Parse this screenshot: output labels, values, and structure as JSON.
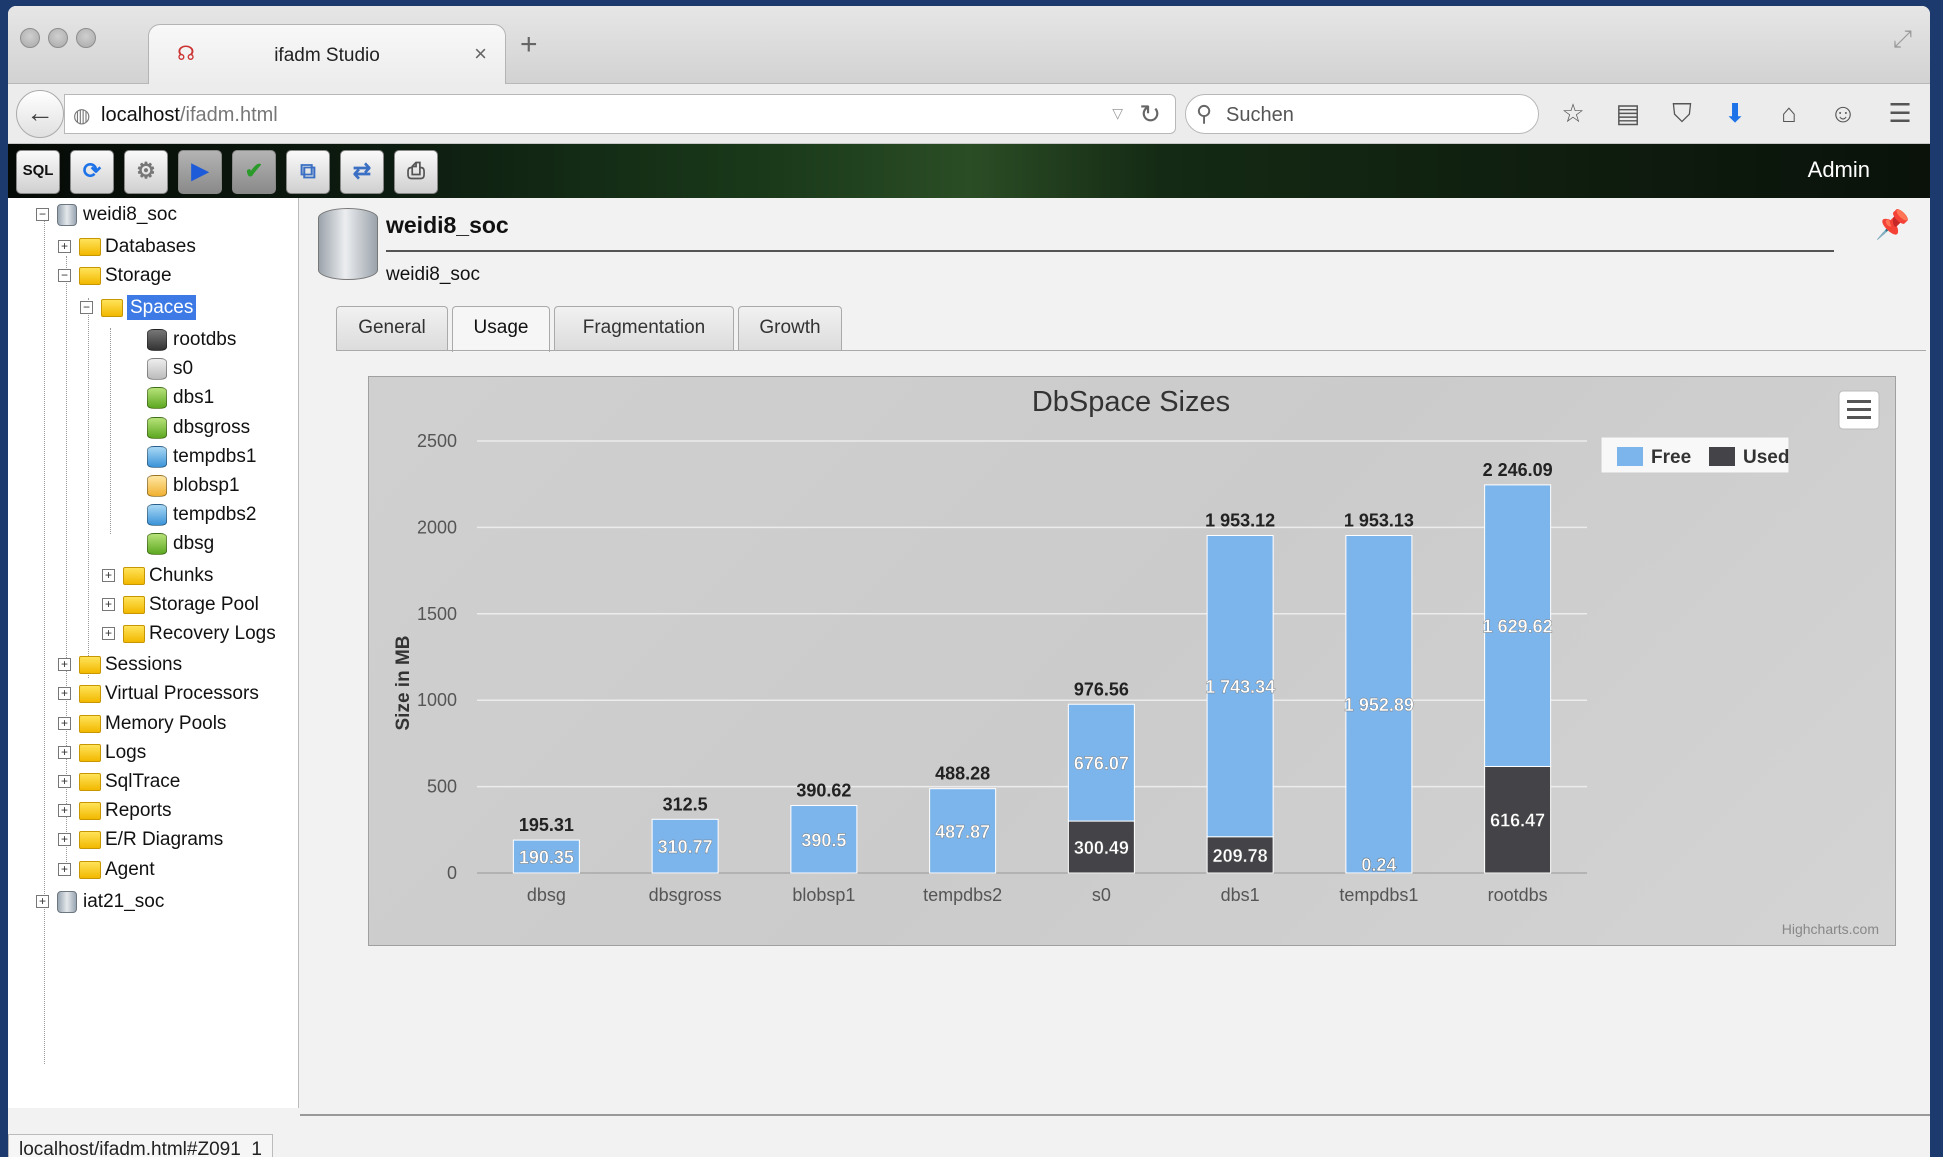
{
  "browser": {
    "tab_title": "ifadm Studio",
    "tab_close": "×",
    "new_tab": "+",
    "url_host": "localhost",
    "url_path": "/ifadm.html",
    "search_placeholder": "Suchen",
    "status_url": "localhost/ifadm.html#Z091_1",
    "icons": [
      "back-arrow-icon",
      "globe-icon",
      "reload-icon",
      "search-icon",
      "star-icon",
      "reading-list-icon",
      "pocket-icon",
      "download-icon",
      "home-icon",
      "smiley-icon",
      "menu-icon",
      "expand-icon"
    ]
  },
  "toolbar": {
    "buttons": [
      {
        "name": "sql",
        "label": "SQL"
      },
      {
        "name": "refresh",
        "label": "⟳"
      },
      {
        "name": "settings",
        "label": "⚙"
      },
      {
        "name": "run",
        "label": "▶"
      },
      {
        "name": "check",
        "label": "✔"
      },
      {
        "name": "copy",
        "label": "⧉"
      },
      {
        "name": "compare",
        "label": "⇄"
      },
      {
        "name": "print",
        "label": "⎙"
      }
    ],
    "user": "Admin"
  },
  "tree": {
    "server1": "weidi8_soc",
    "databases": "Databases",
    "storage": "Storage",
    "spaces": "Spaces",
    "space_items": [
      "rootdbs",
      "s0",
      "dbs1",
      "dbsgross",
      "tempdbs1",
      "blobsp1",
      "tempdbs2",
      "dbsg"
    ],
    "chunks": "Chunks",
    "storage_pool": "Storage Pool",
    "recovery_logs": "Recovery Logs",
    "sessions": "Sessions",
    "virtual_processors": "Virtual Processors",
    "memory_pools": "Memory Pools",
    "logs": "Logs",
    "sqltrace": "SqlTrace",
    "reports": "Reports",
    "er_diagrams": "E/R Diagrams",
    "agent": "Agent",
    "server2": "iat21_soc",
    "expand_open": "−",
    "expand_closed": "+"
  },
  "colors": {
    "free": "#7cb5ec",
    "used": "#434348",
    "selected": "#3d7ae5"
  },
  "main": {
    "title": "weidi8_soc",
    "subtitle": "weidi8_soc",
    "tabs": [
      {
        "label": "General"
      },
      {
        "label": "Usage"
      },
      {
        "label": "Fragmentation"
      },
      {
        "label": "Growth"
      }
    ]
  },
  "chart_data": {
    "type": "bar",
    "stacked": true,
    "title": "DbSpace Sizes",
    "ylabel": "Size in MB",
    "ylim": [
      0,
      2500
    ],
    "yticks": [
      0,
      500,
      1000,
      1500,
      2000,
      2500
    ],
    "categories": [
      "dbsg",
      "dbsgross",
      "blobsp1",
      "tempdbs2",
      "s0",
      "dbs1",
      "tempdbs1",
      "rootdbs"
    ],
    "series": [
      {
        "name": "Free",
        "values": [
          190.35,
          310.77,
          390.5,
          487.87,
          676.07,
          1743.34,
          1952.89,
          1629.62
        ],
        "labels": [
          "190.35",
          "310.77",
          "390.5",
          "487.87",
          "676.07",
          "1 743.34",
          "1 952.89",
          "1 629.62"
        ]
      },
      {
        "name": "Used",
        "values": [
          0,
          0,
          0,
          0,
          300.49,
          209.78,
          0.24,
          616.47
        ],
        "labels": [
          "",
          "",
          "",
          "",
          "300.49",
          "209.78",
          "0.24",
          "616.47"
        ]
      }
    ],
    "totals": [
      195.31,
      312.5,
      390.62,
      488.28,
      976.56,
      1953.12,
      1953.13,
      2246.09
    ],
    "total_labels": [
      "195.31",
      "312.5",
      "390.62",
      "488.28",
      "976.56",
      "1 953.12",
      "1 953.13",
      "2 246.09"
    ],
    "legend_position": "top-right",
    "credits": "Highcharts.com",
    "grid": true
  }
}
